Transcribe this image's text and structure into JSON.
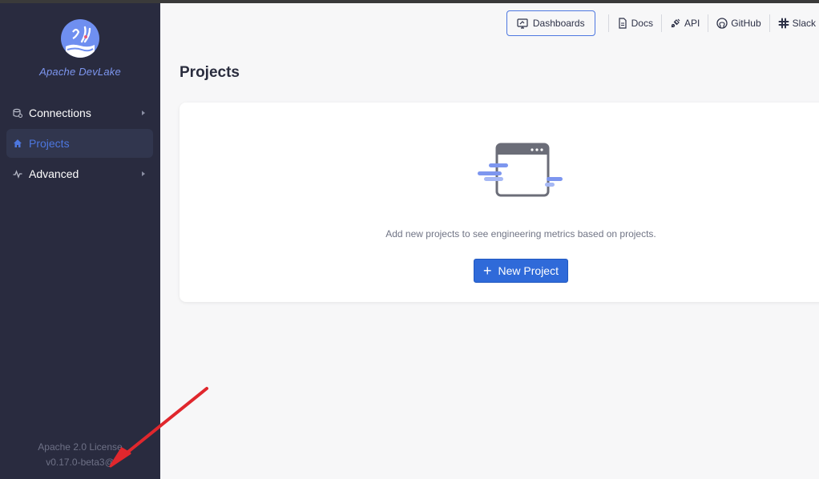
{
  "app": {
    "brand": "Apache DevLake"
  },
  "sidebar": {
    "items": [
      {
        "label": "Connections",
        "icon": "database-icon",
        "has_submenu": true,
        "active": false
      },
      {
        "label": "Projects",
        "icon": "home-icon",
        "has_submenu": false,
        "active": true
      },
      {
        "label": "Advanced",
        "icon": "pulse-icon",
        "has_submenu": true,
        "active": false
      }
    ],
    "footer": {
      "license": "Apache 2.0 License",
      "version": "v0.17.0-beta3@"
    }
  },
  "header": {
    "dashboards_label": "Dashboards",
    "links": [
      {
        "label": "Docs",
        "icon": "document-icon"
      },
      {
        "label": "API",
        "icon": "plug-icon"
      },
      {
        "label": "GitHub",
        "icon": "github-icon"
      },
      {
        "label": "Slack",
        "icon": "slack-icon"
      }
    ]
  },
  "main": {
    "title": "Projects",
    "empty_message": "Add new projects to see engineering metrics based on projects.",
    "new_project_label": "New Project"
  },
  "colors": {
    "sidebar_bg": "#292b3f",
    "accent": "#4d77e0",
    "primary_button": "#2f6ad9",
    "annotation_arrow": "#e0272d"
  }
}
